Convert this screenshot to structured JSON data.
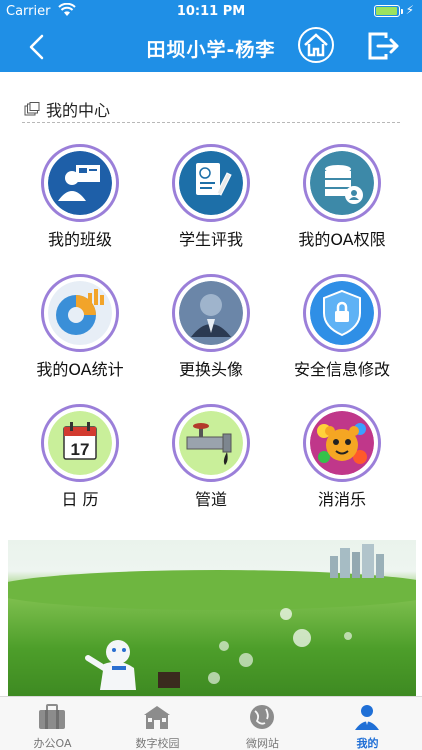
{
  "status_bar": {
    "carrier": "Carrier",
    "time": "10:11 PM",
    "bolt": "⚡",
    "battery_level": 0.95
  },
  "header": {
    "title": "田坝小学-杨李"
  },
  "section": {
    "title": "我的中心"
  },
  "tiles": [
    {
      "label": "我的班级",
      "icon": "class-board-icon"
    },
    {
      "label": "学生评我",
      "icon": "evaluation-sheet-icon"
    },
    {
      "label": "我的OA权限",
      "icon": "database-user-icon"
    },
    {
      "label": "我的OA统计",
      "icon": "pie-chart-icon"
    },
    {
      "label": "更换头像",
      "icon": "avatar-icon"
    },
    {
      "label": "安全信息修改",
      "icon": "shield-lock-icon"
    },
    {
      "label": "日 历",
      "icon": "calendar-icon",
      "date": "17"
    },
    {
      "label": "管道",
      "icon": "pipe-icon"
    },
    {
      "label": "消消乐",
      "icon": "game-icon"
    }
  ],
  "tabbar": {
    "items": [
      {
        "label": "办公OA",
        "icon": "briefcase-icon"
      },
      {
        "label": "数字校园",
        "icon": "school-building-icon"
      },
      {
        "label": "微网站",
        "icon": "globe-icon"
      },
      {
        "label": "我的",
        "icon": "person-icon",
        "active": true
      }
    ]
  },
  "colors": {
    "header": "#1f8fe6",
    "tile_ring": "#9b7fd9",
    "active_tab": "#1f6fd6"
  }
}
